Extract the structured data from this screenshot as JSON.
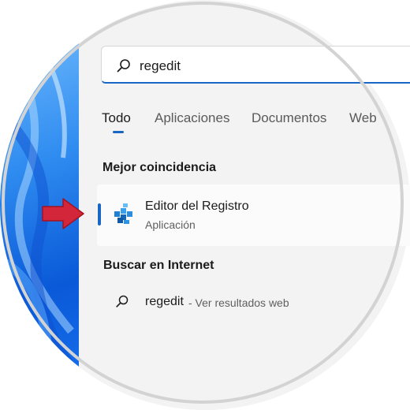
{
  "search": {
    "query": "regedit"
  },
  "tabs": [
    {
      "label": "Todo"
    },
    {
      "label": "Aplicaciones"
    },
    {
      "label": "Documentos"
    },
    {
      "label": "Web"
    }
  ],
  "best_match": {
    "heading": "Mejor coincidencia",
    "app_name": "Editor del Registro",
    "app_type": "Aplicación",
    "icon": "registry-editor-icon"
  },
  "internet": {
    "heading": "Buscar en Internet",
    "query": "regedit",
    "suffix": " - Ver resultados web"
  },
  "colors": {
    "accent": "#1a66c4",
    "arrow": "#d3263a"
  }
}
